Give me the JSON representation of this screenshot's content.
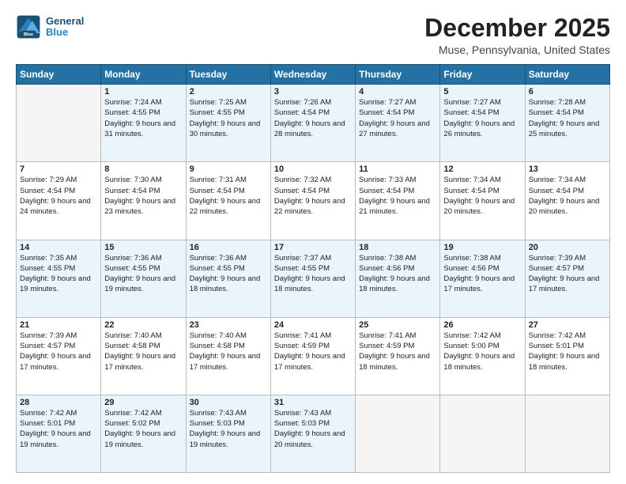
{
  "header": {
    "logo_line1": "General",
    "logo_line2": "Blue",
    "month": "December 2025",
    "location": "Muse, Pennsylvania, United States"
  },
  "days_of_week": [
    "Sunday",
    "Monday",
    "Tuesday",
    "Wednesday",
    "Thursday",
    "Friday",
    "Saturday"
  ],
  "weeks": [
    [
      {
        "day": "",
        "empty": true
      },
      {
        "day": "1",
        "sunrise": "Sunrise: 7:24 AM",
        "sunset": "Sunset: 4:55 PM",
        "daylight": "Daylight: 9 hours and 31 minutes."
      },
      {
        "day": "2",
        "sunrise": "Sunrise: 7:25 AM",
        "sunset": "Sunset: 4:55 PM",
        "daylight": "Daylight: 9 hours and 30 minutes."
      },
      {
        "day": "3",
        "sunrise": "Sunrise: 7:26 AM",
        "sunset": "Sunset: 4:54 PM",
        "daylight": "Daylight: 9 hours and 28 minutes."
      },
      {
        "day": "4",
        "sunrise": "Sunrise: 7:27 AM",
        "sunset": "Sunset: 4:54 PM",
        "daylight": "Daylight: 9 hours and 27 minutes."
      },
      {
        "day": "5",
        "sunrise": "Sunrise: 7:27 AM",
        "sunset": "Sunset: 4:54 PM",
        "daylight": "Daylight: 9 hours and 26 minutes."
      },
      {
        "day": "6",
        "sunrise": "Sunrise: 7:28 AM",
        "sunset": "Sunset: 4:54 PM",
        "daylight": "Daylight: 9 hours and 25 minutes."
      }
    ],
    [
      {
        "day": "7",
        "sunrise": "Sunrise: 7:29 AM",
        "sunset": "Sunset: 4:54 PM",
        "daylight": "Daylight: 9 hours and 24 minutes."
      },
      {
        "day": "8",
        "sunrise": "Sunrise: 7:30 AM",
        "sunset": "Sunset: 4:54 PM",
        "daylight": "Daylight: 9 hours and 23 minutes."
      },
      {
        "day": "9",
        "sunrise": "Sunrise: 7:31 AM",
        "sunset": "Sunset: 4:54 PM",
        "daylight": "Daylight: 9 hours and 22 minutes."
      },
      {
        "day": "10",
        "sunrise": "Sunrise: 7:32 AM",
        "sunset": "Sunset: 4:54 PM",
        "daylight": "Daylight: 9 hours and 22 minutes."
      },
      {
        "day": "11",
        "sunrise": "Sunrise: 7:33 AM",
        "sunset": "Sunset: 4:54 PM",
        "daylight": "Daylight: 9 hours and 21 minutes."
      },
      {
        "day": "12",
        "sunrise": "Sunrise: 7:34 AM",
        "sunset": "Sunset: 4:54 PM",
        "daylight": "Daylight: 9 hours and 20 minutes."
      },
      {
        "day": "13",
        "sunrise": "Sunrise: 7:34 AM",
        "sunset": "Sunset: 4:54 PM",
        "daylight": "Daylight: 9 hours and 20 minutes."
      }
    ],
    [
      {
        "day": "14",
        "sunrise": "Sunrise: 7:35 AM",
        "sunset": "Sunset: 4:55 PM",
        "daylight": "Daylight: 9 hours and 19 minutes."
      },
      {
        "day": "15",
        "sunrise": "Sunrise: 7:36 AM",
        "sunset": "Sunset: 4:55 PM",
        "daylight": "Daylight: 9 hours and 19 minutes."
      },
      {
        "day": "16",
        "sunrise": "Sunrise: 7:36 AM",
        "sunset": "Sunset: 4:55 PM",
        "daylight": "Daylight: 9 hours and 18 minutes."
      },
      {
        "day": "17",
        "sunrise": "Sunrise: 7:37 AM",
        "sunset": "Sunset: 4:55 PM",
        "daylight": "Daylight: 9 hours and 18 minutes."
      },
      {
        "day": "18",
        "sunrise": "Sunrise: 7:38 AM",
        "sunset": "Sunset: 4:56 PM",
        "daylight": "Daylight: 9 hours and 18 minutes."
      },
      {
        "day": "19",
        "sunrise": "Sunrise: 7:38 AM",
        "sunset": "Sunset: 4:56 PM",
        "daylight": "Daylight: 9 hours and 17 minutes."
      },
      {
        "day": "20",
        "sunrise": "Sunrise: 7:39 AM",
        "sunset": "Sunset: 4:57 PM",
        "daylight": "Daylight: 9 hours and 17 minutes."
      }
    ],
    [
      {
        "day": "21",
        "sunrise": "Sunrise: 7:39 AM",
        "sunset": "Sunset: 4:57 PM",
        "daylight": "Daylight: 9 hours and 17 minutes."
      },
      {
        "day": "22",
        "sunrise": "Sunrise: 7:40 AM",
        "sunset": "Sunset: 4:58 PM",
        "daylight": "Daylight: 9 hours and 17 minutes."
      },
      {
        "day": "23",
        "sunrise": "Sunrise: 7:40 AM",
        "sunset": "Sunset: 4:58 PM",
        "daylight": "Daylight: 9 hours and 17 minutes."
      },
      {
        "day": "24",
        "sunrise": "Sunrise: 7:41 AM",
        "sunset": "Sunset: 4:59 PM",
        "daylight": "Daylight: 9 hours and 17 minutes."
      },
      {
        "day": "25",
        "sunrise": "Sunrise: 7:41 AM",
        "sunset": "Sunset: 4:59 PM",
        "daylight": "Daylight: 9 hours and 18 minutes."
      },
      {
        "day": "26",
        "sunrise": "Sunrise: 7:42 AM",
        "sunset": "Sunset: 5:00 PM",
        "daylight": "Daylight: 9 hours and 18 minutes."
      },
      {
        "day": "27",
        "sunrise": "Sunrise: 7:42 AM",
        "sunset": "Sunset: 5:01 PM",
        "daylight": "Daylight: 9 hours and 18 minutes."
      }
    ],
    [
      {
        "day": "28",
        "sunrise": "Sunrise: 7:42 AM",
        "sunset": "Sunset: 5:01 PM",
        "daylight": "Daylight: 9 hours and 19 minutes."
      },
      {
        "day": "29",
        "sunrise": "Sunrise: 7:42 AM",
        "sunset": "Sunset: 5:02 PM",
        "daylight": "Daylight: 9 hours and 19 minutes."
      },
      {
        "day": "30",
        "sunrise": "Sunrise: 7:43 AM",
        "sunset": "Sunset: 5:03 PM",
        "daylight": "Daylight: 9 hours and 19 minutes."
      },
      {
        "day": "31",
        "sunrise": "Sunrise: 7:43 AM",
        "sunset": "Sunset: 5:03 PM",
        "daylight": "Daylight: 9 hours and 20 minutes."
      },
      {
        "day": "",
        "empty": true
      },
      {
        "day": "",
        "empty": true
      },
      {
        "day": "",
        "empty": true
      }
    ]
  ]
}
